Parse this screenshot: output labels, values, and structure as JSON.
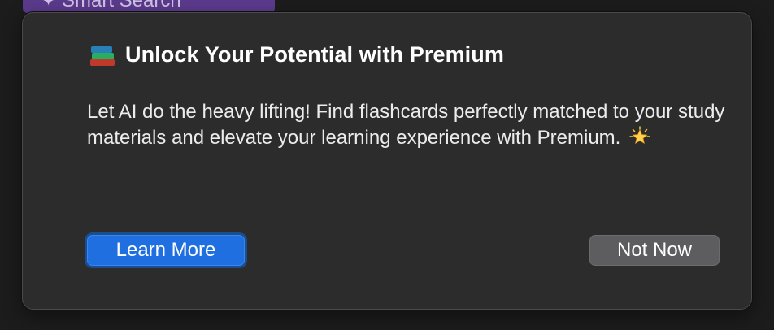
{
  "background": {
    "smart_search_label": "Smart Search",
    "smart_search_icon": "sparkle-icon"
  },
  "dialog": {
    "title_icon": "books-icon",
    "title": "Unlock Your Potential with Premium",
    "message": "Let AI do the heavy lifting! Find flashcards perfectly matched to your study materials and elevate your learning experience with Premium.",
    "message_icon": "glowing-star-icon",
    "primary_button": "Learn More",
    "secondary_button": "Not Now"
  },
  "colors": {
    "dialog_background": "#2c2c2d",
    "primary_button": "#1f6fe0",
    "secondary_button": "#5d5d5f",
    "smart_search_button": "#5b3a8c"
  }
}
